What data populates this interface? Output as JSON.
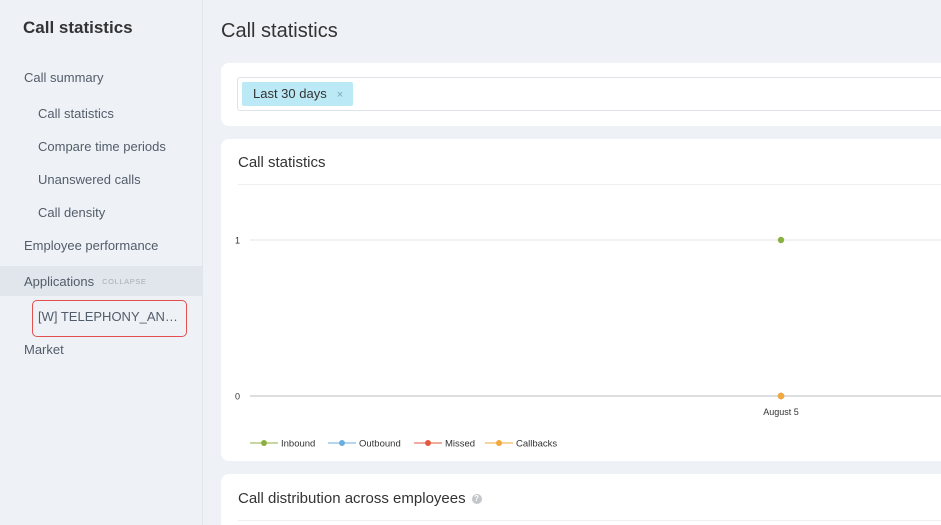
{
  "sidebar": {
    "title": "Call statistics",
    "items": [
      {
        "label": "Call summary"
      },
      {
        "label": "Call statistics"
      },
      {
        "label": "Compare time periods"
      },
      {
        "label": "Unanswered calls"
      },
      {
        "label": "Call density"
      },
      {
        "label": "Employee performance"
      },
      {
        "label": "Applications"
      },
      {
        "label": "Market"
      }
    ],
    "collapse_label": "COLLAPSE",
    "app_item": "[W] TELEPHONY_ANALYTICS"
  },
  "page_title": "Call statistics",
  "filter": {
    "chip_label": "Last 30 days",
    "chip_close": "×"
  },
  "stats_card": {
    "title": "Call statistics"
  },
  "dist_card": {
    "title": "Call distribution across employees",
    "help": "?"
  },
  "colors": {
    "inbound": "#8cb040",
    "outbound": "#6aaee0",
    "missed": "#e05a3f",
    "callbacks": "#f2a93b",
    "highlight_border": "#e35050",
    "chip_bg": "#bce9f6"
  },
  "chart_data": {
    "type": "line",
    "categories": [
      "August 5"
    ],
    "ylim": [
      0,
      1
    ],
    "yticks": [
      "0",
      "1"
    ],
    "series": [
      {
        "name": "Inbound",
        "values": [
          1
        ],
        "color": "#8cb040"
      },
      {
        "name": "Outbound",
        "values": [
          0
        ],
        "color": "#6aaee0"
      },
      {
        "name": "Missed",
        "values": [
          0
        ],
        "color": "#e05a3f"
      },
      {
        "name": "Callbacks",
        "values": [
          0
        ],
        "color": "#f2a93b"
      }
    ],
    "legend": "bottom-left",
    "grid": true
  }
}
